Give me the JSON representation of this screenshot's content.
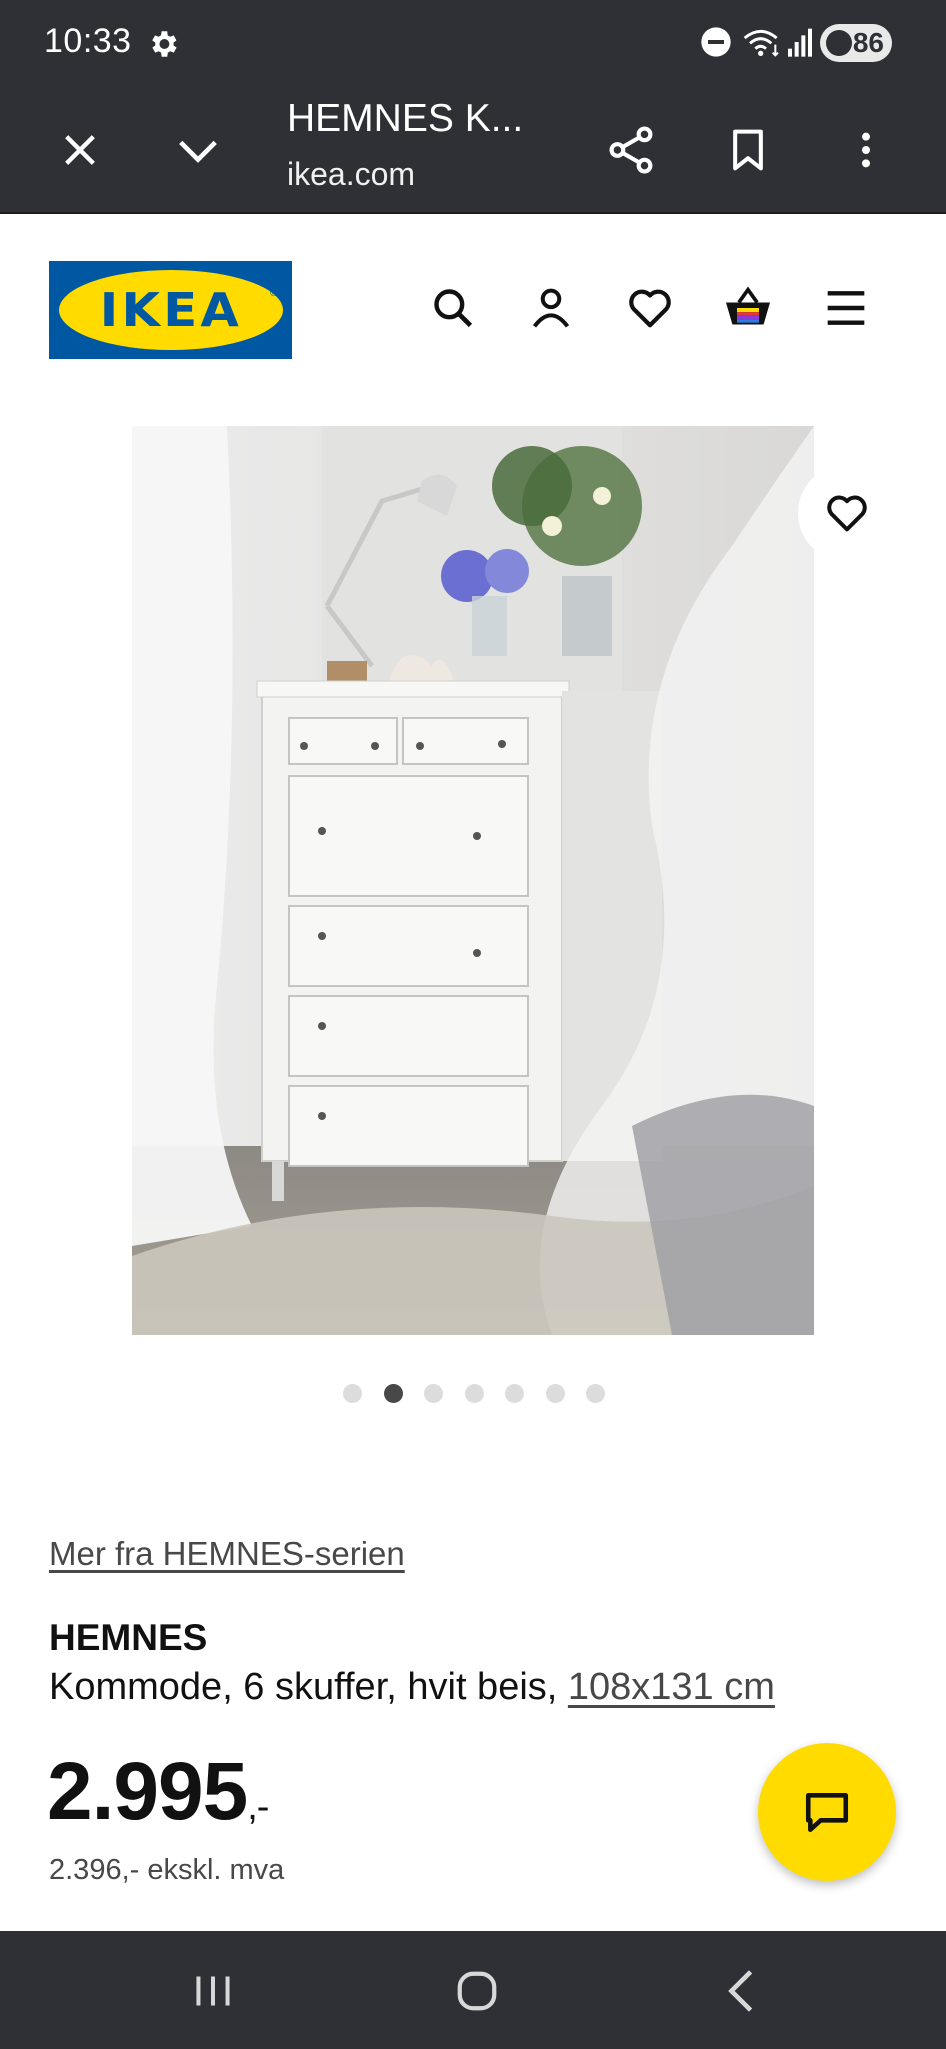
{
  "status_bar": {
    "time": "10:33",
    "battery": "86",
    "icons": [
      "gear-icon",
      "do-not-disturb-icon",
      "wifi-icon",
      "signal-icon",
      "battery-icon"
    ]
  },
  "browser": {
    "page_title": "HEMNES K...",
    "url": "ikea.com",
    "icons": [
      "close-icon",
      "chevron-down-icon",
      "share-icon",
      "bookmark-icon",
      "more-vert-icon"
    ]
  },
  "site_header": {
    "logo_text": "IKEA",
    "logo_mark": "®",
    "icons": [
      "search-icon",
      "profile-icon",
      "heart-icon",
      "basket-icon",
      "menu-icon"
    ]
  },
  "gallery": {
    "image_count": 7,
    "active_index": 1
  },
  "product": {
    "series_link": "Mer fra HEMNES-serien",
    "name": "HEMNES",
    "description": "Kommode, 6 skuffer, hvit beis, ",
    "dimensions": "108x131 cm",
    "price": "2.995",
    "price_suffix": ",-",
    "price_ex_vat": "2.396,- ekskl. mva"
  },
  "colors": {
    "ikea_blue": "#0058a3",
    "ikea_yellow": "#ffdb00",
    "chrome_dark": "#2f3035"
  }
}
